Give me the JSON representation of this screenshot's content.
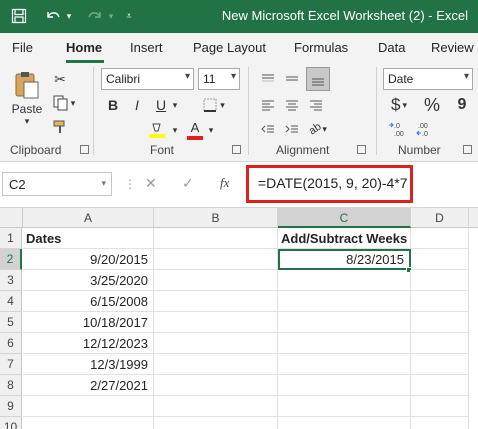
{
  "window": {
    "title": "New Microsoft Excel Worksheet (2)  -  Excel"
  },
  "tabs": [
    "File",
    "Home",
    "Insert",
    "Page Layout",
    "Formulas",
    "Data",
    "Review"
  ],
  "active_tab": "Home",
  "ribbon": {
    "clipboard": {
      "paste_label": "Paste",
      "group_label": "Clipboard"
    },
    "font": {
      "name": "Calibri",
      "size": "11",
      "group_label": "Font",
      "bold": "B",
      "italic": "I",
      "underline": "U",
      "font_color_glyph": "A"
    },
    "alignment": {
      "group_label": "Alignment"
    },
    "number": {
      "format": "Date",
      "group_label": "Number",
      "currency": "$",
      "percent": "%",
      "comma": "9"
    }
  },
  "formula_bar": {
    "name_box": "C2",
    "fx": "fx",
    "formula": "=DATE(2015, 9, 20)-4*7"
  },
  "grid": {
    "columns": [
      "A",
      "B",
      "C",
      "D"
    ],
    "rows": [
      "1",
      "2",
      "3",
      "4",
      "5",
      "6",
      "7",
      "8",
      "9",
      "10"
    ],
    "colA": [
      "Dates",
      "9/20/2015",
      "3/25/2020",
      "6/15/2008",
      "10/18/2017",
      "12/12/2023",
      "12/3/1999",
      "2/27/2021"
    ],
    "c1": "Add/Subtract Weeks",
    "c2": "8/23/2015"
  },
  "colors": {
    "excel_green": "#217346",
    "highlight_red": "#e01f1f"
  }
}
